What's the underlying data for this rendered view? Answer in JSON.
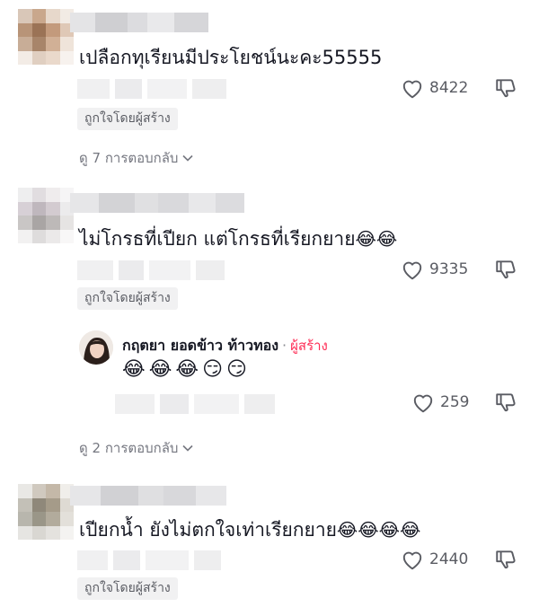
{
  "comments": [
    {
      "text": "เปลือกทุเรียนมีประโยชน์นะคะ55555",
      "likes": "8422",
      "badge": "ถูกใจโดยผู้สร้าง",
      "replies_label": "ดู 7 การตอบกลับ"
    },
    {
      "text": "ไม่โกรธที่เปียก แต่โกรธที่เรียกยาย",
      "emojis": "😂😂",
      "likes": "9335",
      "badge": "ถูกใจโดยผู้สร้าง",
      "reply": {
        "name": "กฤตยา ยอดข้าว ท้าวทอง",
        "separator": "·",
        "creator_label": "ผู้สร้าง",
        "emojis": "😂😂😂😏😏",
        "likes": "259"
      },
      "replies_label": "ดู 2 การตอบกลับ"
    },
    {
      "text": "เปียกน้ำ ยังไม่ตกใจเท่าเรียกยาย",
      "emojis": "😂😂😂😂",
      "likes": "2440",
      "badge": "ถูกใจโดยผู้สร้าง"
    }
  ],
  "icons": {
    "like": "heart-outline-icon",
    "dislike": "thumbs-down-icon",
    "chevron": "chevron-down-icon"
  },
  "colors": {
    "text": "#161823",
    "secondary": "#5a5c63",
    "creator": "#fe2c55",
    "badge_bg": "#f1f1f2"
  }
}
